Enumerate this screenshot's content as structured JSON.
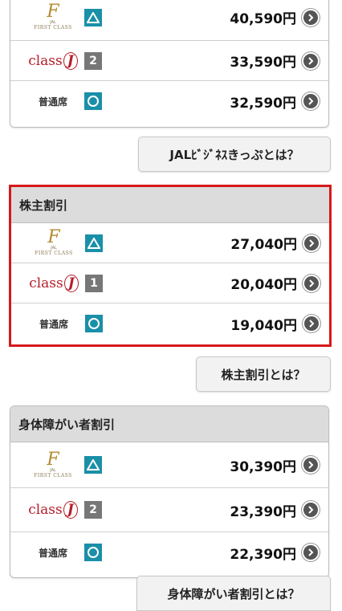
{
  "sections": {
    "top": {
      "rows": [
        {
          "class_logo": "first-class-logo",
          "seat_logo_text": {
            "f": "F",
            "jal": "JAL",
            "fc": "FIRST CLASS"
          },
          "availability": "△",
          "price": "40,590円"
        },
        {
          "class_logo": "class-j-logo",
          "class_text": "class",
          "j": "J",
          "availability": "2",
          "price": "33,590円"
        },
        {
          "class_logo": "ordinary-seat",
          "class_text": "普通席",
          "availability": "○",
          "price": "32,590円"
        }
      ],
      "link_label": "JALﾋﾞｼﾞﾈｽきっぷとは？"
    },
    "kabu": {
      "title": "株主割引",
      "rows": [
        {
          "class_logo": "first-class-logo",
          "seat_logo_text": {
            "f": "F",
            "jal": "JAL",
            "fc": "FIRST CLASS"
          },
          "availability": "△",
          "price": "27,040円"
        },
        {
          "class_logo": "class-j-logo",
          "class_text": "class",
          "j": "J",
          "availability": "1",
          "price": "20,040円"
        },
        {
          "class_logo": "ordinary-seat",
          "class_text": "普通席",
          "availability": "○",
          "price": "19,040円"
        }
      ],
      "link_label": "株主割引とは？",
      "highlight_color": "#d6191b"
    },
    "shinsho": {
      "title": "身体障がい者割引",
      "rows": [
        {
          "class_logo": "first-class-logo",
          "seat_logo_text": {
            "f": "F",
            "jal": "JAL",
            "fc": "FIRST CLASS"
          },
          "availability": "△",
          "price": "30,390円"
        },
        {
          "class_logo": "class-j-logo",
          "class_text": "class",
          "j": "J",
          "availability": "2",
          "price": "23,390円"
        },
        {
          "class_logo": "ordinary-seat",
          "class_text": "普通席",
          "availability": "○",
          "price": "22,390円"
        }
      ],
      "link_label": "身体障がい者割引とは？"
    }
  },
  "icons": {
    "availability_few": "triangle-icon",
    "availability_ok": "circle-icon",
    "go": "chevron-right-icon"
  },
  "colors": {
    "badge_teal": "#1a8fa8",
    "badge_gray": "#777777",
    "class_j_red": "#b51d2a",
    "first_class_gold": "#b38a2e"
  }
}
